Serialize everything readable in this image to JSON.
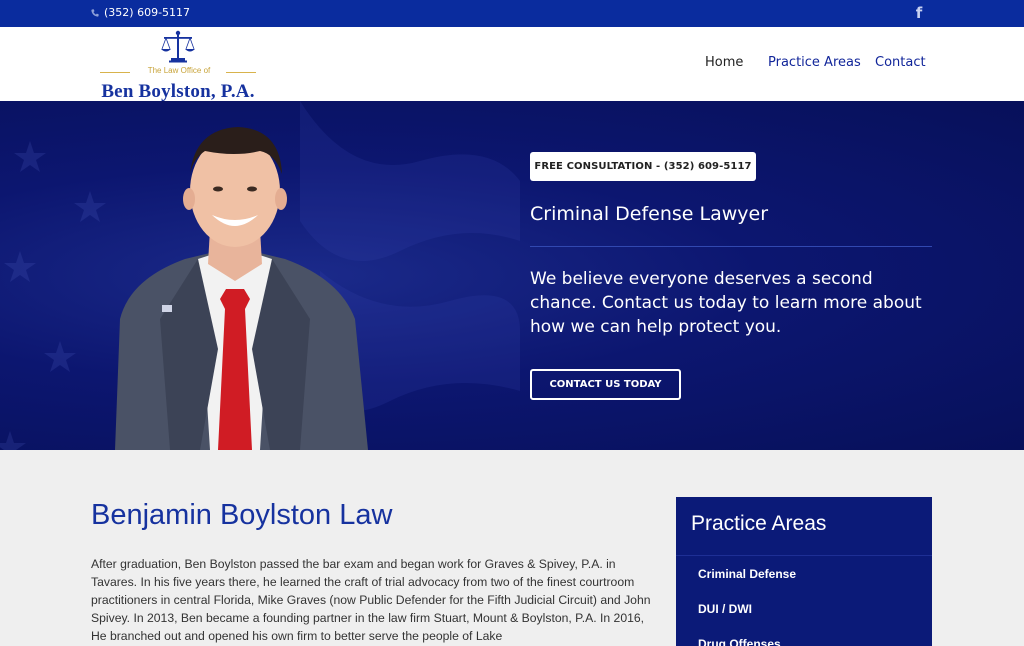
{
  "topbar": {
    "phone": "(352) 609-5117",
    "facebook_icon": "facebook-icon"
  },
  "header": {
    "logo": {
      "line1": "The Law Office of",
      "line2": "Ben Boylston, P.A."
    },
    "nav": [
      {
        "label": "Home",
        "active": true
      },
      {
        "label": "Practice Areas",
        "active": false
      },
      {
        "label": "Contact",
        "active": false
      }
    ]
  },
  "hero": {
    "consult_button": "FREE CONSULTATION - (352) 609-5117",
    "title": "Criminal Defense Lawyer",
    "text": "We believe everyone deserves a second chance. Contact us today to learn more about how we can help protect you.",
    "contact_button": "CONTACT US TODAY"
  },
  "main": {
    "title": "Benjamin Boylston Law",
    "paragraph": "After graduation, Ben Boylston passed the bar exam and began work for Graves & Spivey, P.A. in Tavares. In his five years there, he learned the craft of trial advocacy from two of the finest courtroom practitioners in central Florida, Mike Graves (now Public Defender for the Fifth Judicial Circuit) and John Spivey. In 2013, Ben became a founding partner in the law firm Stuart, Mount & Boylston, P.A. In 2016, He branched out and opened his own firm to better serve the people of Lake"
  },
  "sidebar": {
    "title": "Practice Areas",
    "items": [
      "Criminal Defense",
      "DUI / DWI",
      "Drug Offenses"
    ]
  },
  "colors": {
    "topbar": "#0a2c9e",
    "brand_blue": "#16329f",
    "hero_navy": "#0c1670",
    "sidebar_navy": "#0b1a78"
  }
}
